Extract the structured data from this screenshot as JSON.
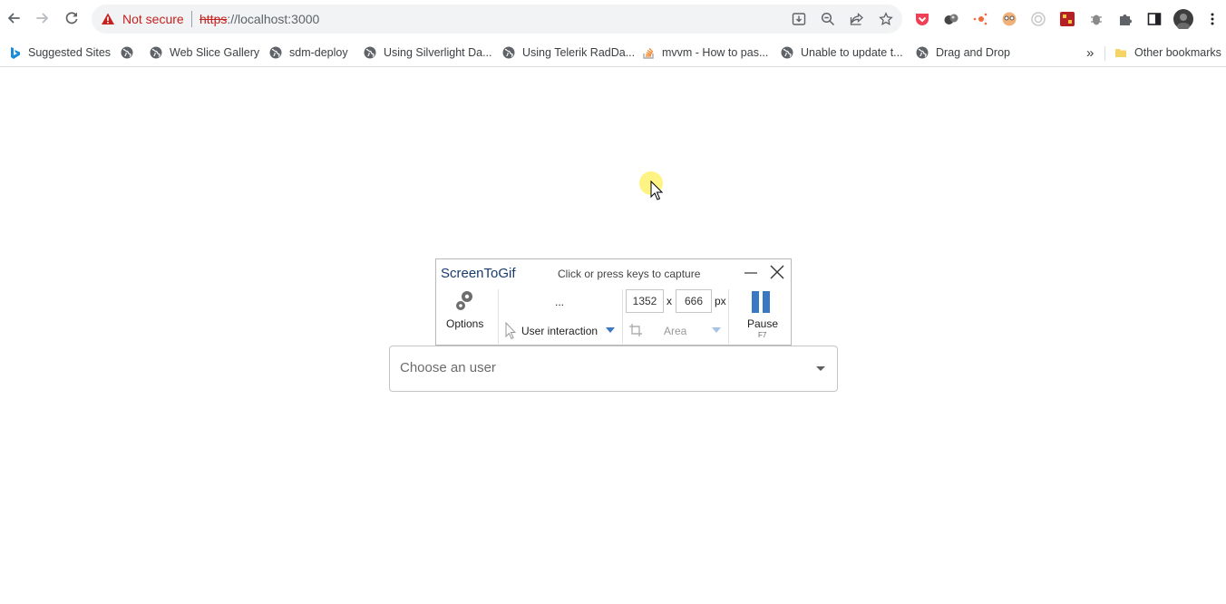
{
  "browser": {
    "security_label": "Not secure",
    "url_protocol": "https",
    "url_rest": "://localhost:3000"
  },
  "bookmarks": {
    "items": [
      {
        "label": "Suggested Sites",
        "icon": "bing-icon"
      },
      {
        "label": "",
        "icon": "globe-icon"
      },
      {
        "label": "Web Slice Gallery",
        "icon": "globe-icon"
      },
      {
        "label": "sdm-deploy",
        "icon": "globe-icon"
      },
      {
        "label": "Using Silverlight Da...",
        "icon": "globe-icon"
      },
      {
        "label": "Using Telerik RadDa...",
        "icon": "globe-icon"
      },
      {
        "label": "mvvm - How to pas...",
        "icon": "stackoverflow-icon"
      },
      {
        "label": "Unable to update t...",
        "icon": "globe-icon"
      },
      {
        "label": "Drag and Drop",
        "icon": "globe-icon"
      }
    ],
    "overflow": "»",
    "other_label": "Other bookmarks"
  },
  "screentogif": {
    "title": "ScreenToGif",
    "hint": "Click or press keys to capture",
    "options_label": "Options",
    "dots": "...",
    "mode_label": "User interaction",
    "width": "1352",
    "times": "x",
    "height": "666",
    "unit": "px",
    "area_label": "Area",
    "pause_label": "Pause",
    "pause_key": "F7"
  },
  "page": {
    "select_placeholder": "Choose an user"
  },
  "colors": {
    "accent": "#3a78c3",
    "warning": "#c5221f",
    "cursor_highlight": "#fff05a"
  }
}
